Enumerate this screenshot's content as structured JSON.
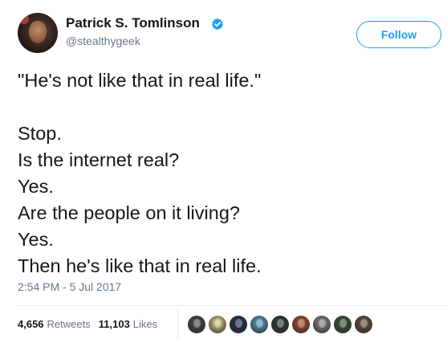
{
  "author": {
    "name": "Patrick S. Tomlinson",
    "handle": "@stealthygeek",
    "verified_icon": "verified-badge-icon"
  },
  "follow_label": "Follow",
  "tweet": {
    "lines": [
      "\"He's not like that in real life.\"",
      "",
      "Stop.",
      "Is the internet real?",
      "Yes.",
      "Are the people on it living?",
      "Yes.",
      "Then he's like that in real life."
    ],
    "timestamp": "2:54 PM - 5 Jul 2017"
  },
  "stats": {
    "retweets_count": "4,656",
    "retweets_label": "Retweets",
    "likes_count": "11,103",
    "likes_label": "Likes"
  },
  "likers": [
    {
      "color": "#4a4a4a"
    },
    {
      "color": "#e8d48a"
    },
    {
      "color": "#1f2f4a"
    },
    {
      "color": "#5aa0c8"
    },
    {
      "color": "#2a3a30"
    },
    {
      "color": "#b0502a"
    },
    {
      "color": "#8a8a8a"
    },
    {
      "color": "#3a5a3a"
    },
    {
      "color": "#6a5040"
    }
  ],
  "colors": {
    "accent": "#1da1f2",
    "text": "#14171a",
    "secondary": "#657786",
    "divider": "#e6ecf0"
  }
}
